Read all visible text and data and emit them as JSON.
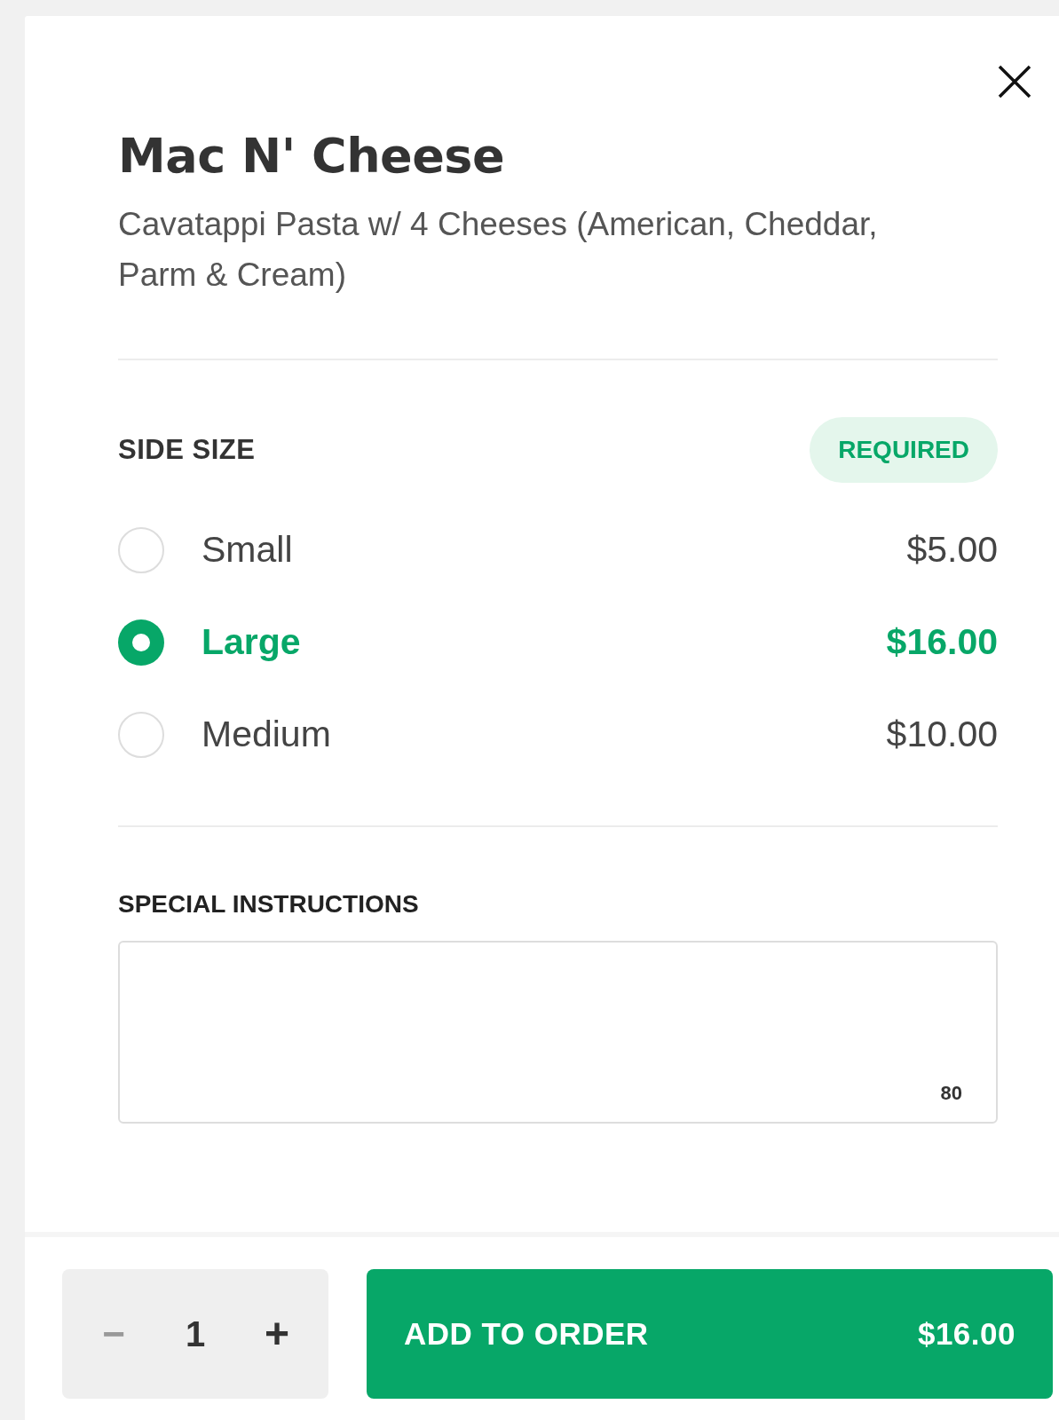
{
  "dialog": {
    "title": "Mac N' Cheese",
    "description": "Cavatappi Pasta w/ 4 Cheeses (American, Cheddar, Parm & Cream)"
  },
  "option_group": {
    "heading": "SIDE SIZE",
    "badge": "REQUIRED",
    "options": [
      {
        "label": "Small",
        "price": "$5.00",
        "selected": false
      },
      {
        "label": "Large",
        "price": "$16.00",
        "selected": true
      },
      {
        "label": "Medium",
        "price": "$10.00",
        "selected": false
      }
    ]
  },
  "special_instructions": {
    "heading": "SPECIAL INSTRUCTIONS",
    "counter": "80"
  },
  "footer": {
    "quantity": "1",
    "minus": "−",
    "plus": "+",
    "add_button": {
      "label": "ADD TO ORDER",
      "price": "$16.00"
    }
  }
}
